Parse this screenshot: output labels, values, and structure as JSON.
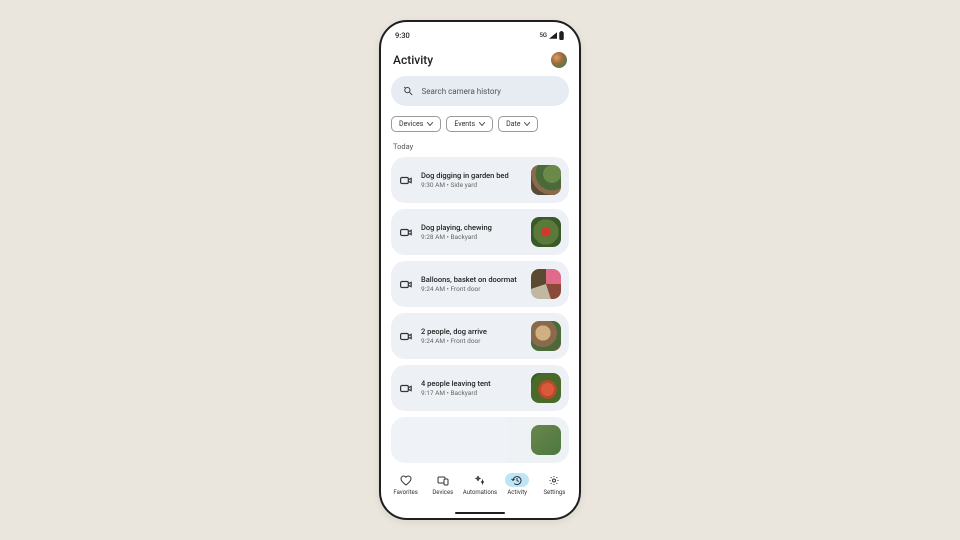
{
  "status": {
    "time": "9:30",
    "network": "5G"
  },
  "header": {
    "title": "Activity"
  },
  "search": {
    "placeholder": "Search camera history"
  },
  "filters": [
    {
      "label": "Devices"
    },
    {
      "label": "Events"
    },
    {
      "label": "Date"
    }
  ],
  "section": {
    "label": "Today"
  },
  "events": [
    {
      "title": "Dog digging in garden bed",
      "time": "9:30 AM",
      "location": "Side yard"
    },
    {
      "title": "Dog playing, chewing",
      "time": "9:28 AM",
      "location": "Backyard"
    },
    {
      "title": "Balloons, basket on doormat",
      "time": "9:24 AM",
      "location": "Front door"
    },
    {
      "title": "2 people, dog arrive",
      "time": "9:24 AM",
      "location": "Front door"
    },
    {
      "title": "4 people leaving tent",
      "time": "9:17 AM",
      "location": "Backyard"
    }
  ],
  "nav": [
    {
      "label": "Favorites"
    },
    {
      "label": "Devices"
    },
    {
      "label": "Automations"
    },
    {
      "label": "Activity"
    },
    {
      "label": "Settings"
    }
  ]
}
